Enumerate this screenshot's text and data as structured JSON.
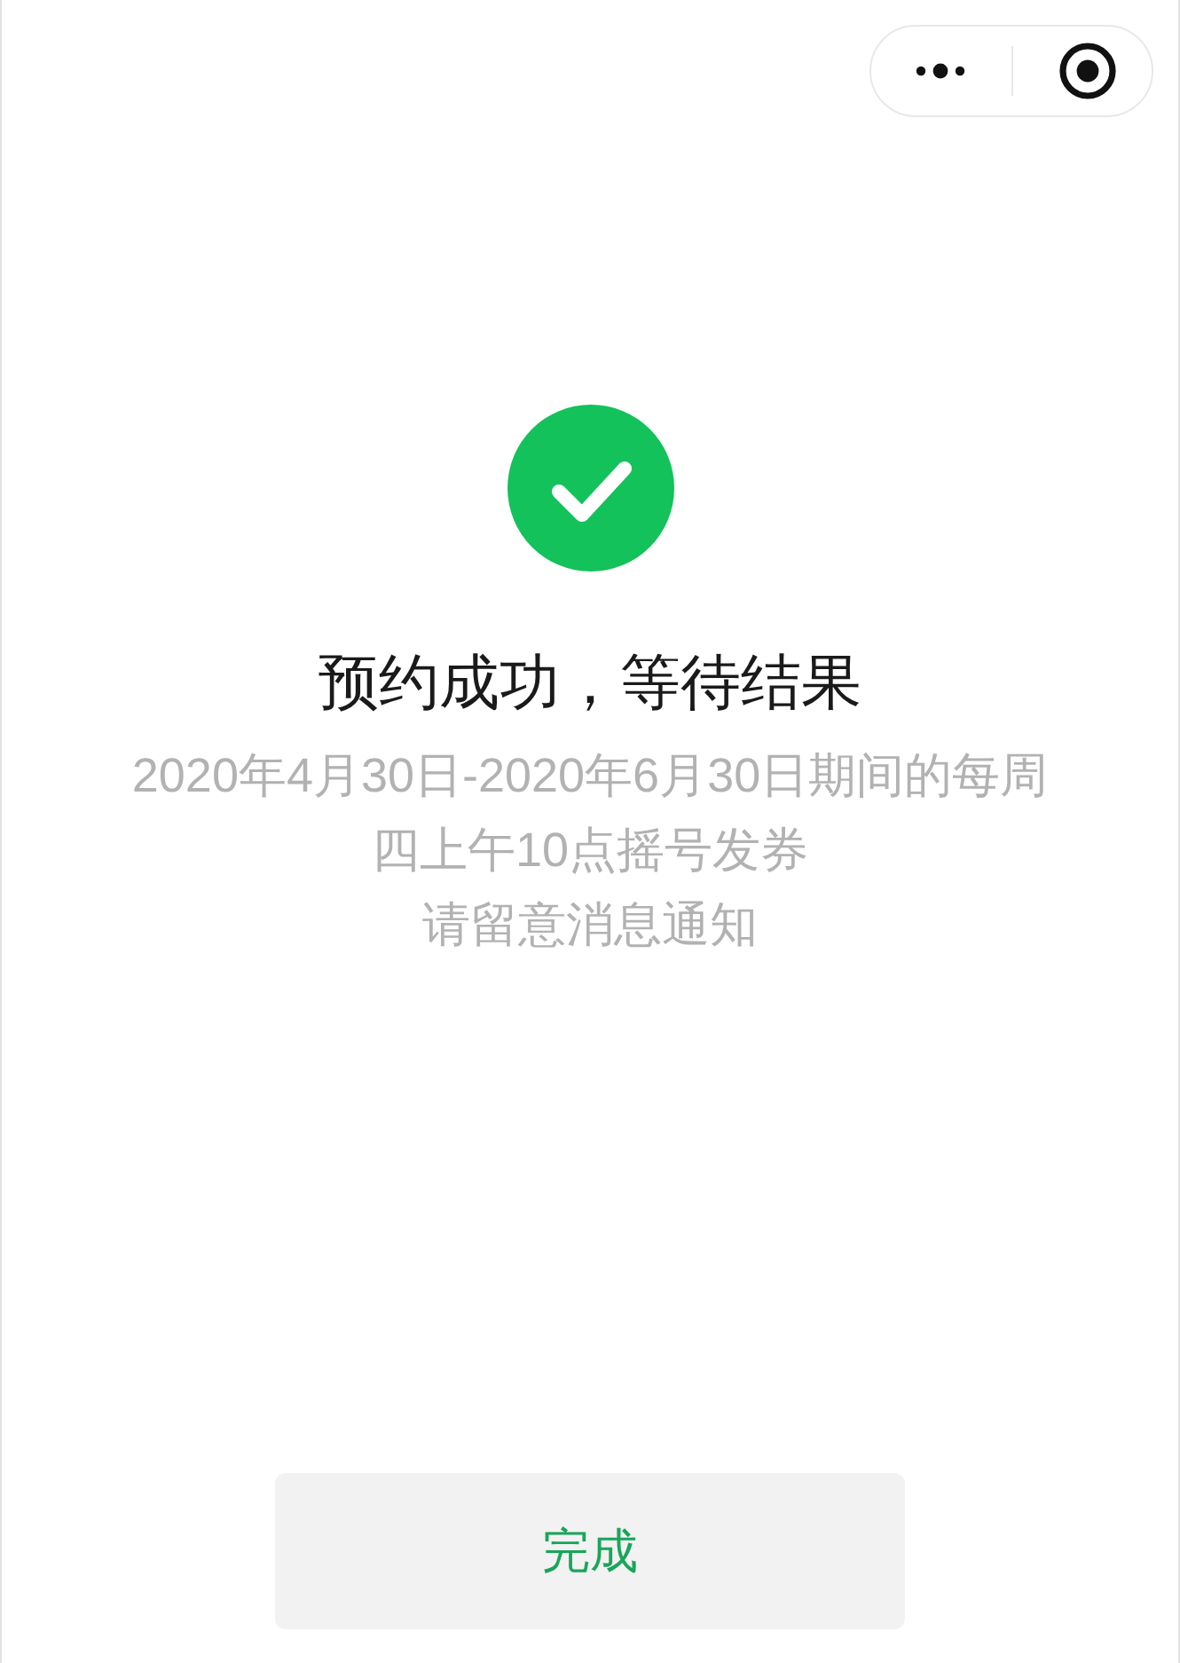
{
  "result": {
    "kind": "success",
    "title": "预约成功，等待结果",
    "description_lines": [
      "2020年4月30日-2020年6月30日期间的每周",
      "四上午10点摇号发券",
      "请留意消息通知"
    ]
  },
  "buttons": [
    {
      "label": "完成"
    }
  ]
}
